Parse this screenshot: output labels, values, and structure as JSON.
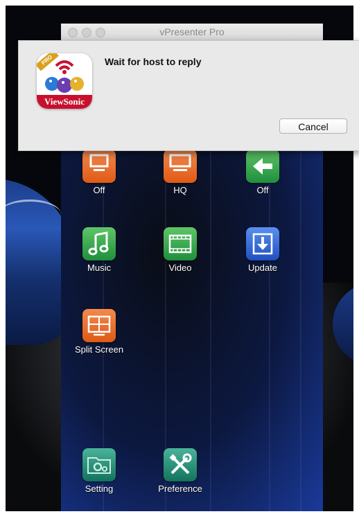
{
  "window": {
    "title": "vPresenter Pro"
  },
  "dialog": {
    "message": "Wait for host to reply",
    "cancel_label": "Cancel",
    "app_icon": {
      "brand": "ViewSonic",
      "badge": "PRO"
    }
  },
  "tiles": [
    {
      "label": "Off",
      "icon": "display-off-icon",
      "color": "#e8682a"
    },
    {
      "label": "HQ",
      "icon": "monitor-hq-icon",
      "color": "#e8682a"
    },
    {
      "label": "Off",
      "icon": "arrow-toggle-icon",
      "color": "#2b9a4b"
    },
    {
      "label": "Music",
      "icon": "music-note-icon",
      "color": "#2b9a4b"
    },
    {
      "label": "Video",
      "icon": "film-strip-icon",
      "color": "#2b9a4b"
    },
    {
      "label": "Update",
      "icon": "download-icon",
      "color": "#2b63d6"
    },
    {
      "label": "Split Screen",
      "icon": "split-screen-icon",
      "color": "#e8682a"
    },
    {
      "label": "Setting",
      "icon": "folder-gear-icon",
      "color": "#1e8a72"
    },
    {
      "label": "Preference",
      "icon": "tools-icon",
      "color": "#1e8a72"
    }
  ]
}
